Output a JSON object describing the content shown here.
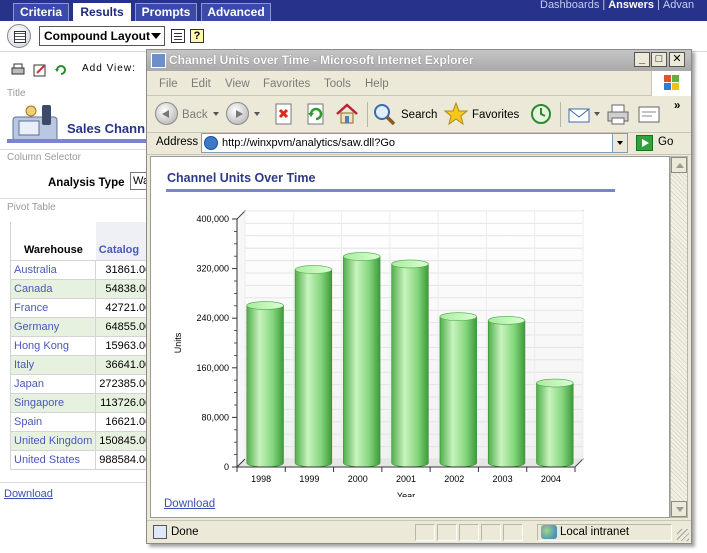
{
  "app": {
    "tabs": [
      {
        "label": "Criteria"
      },
      {
        "label": "Results"
      },
      {
        "label": "Prompts"
      },
      {
        "label": "Advanced"
      }
    ],
    "active_tab": "Results",
    "top_links": [
      "Dashboards",
      "Answers",
      "Advan"
    ],
    "layout_select": "Compound Layout",
    "add_view_label": "Add View:",
    "title_section_label": "Title",
    "title_text": "Sales Chann",
    "column_selector_label": "Column Selector",
    "analysis_type_label": "Analysis Type",
    "analysis_type_value": "Wa",
    "pivot_section_label": "Pivot Table",
    "pivot": {
      "headers": [
        "Warehouse",
        "Catalog"
      ],
      "rows": [
        {
          "name": "Australia",
          "value": "31861.00"
        },
        {
          "name": "Canada",
          "value": "54838.00"
        },
        {
          "name": "France",
          "value": "42721.00"
        },
        {
          "name": "Germany",
          "value": "64855.00"
        },
        {
          "name": "Hong Kong",
          "value": "15963.00"
        },
        {
          "name": "Italy",
          "value": "36641.00"
        },
        {
          "name": "Japan",
          "value": "272385.00"
        },
        {
          "name": "Singapore",
          "value": "113726.00"
        },
        {
          "name": "Spain",
          "value": "16621.00"
        },
        {
          "name": "United Kingdom",
          "value": "150845.00"
        },
        {
          "name": "United States",
          "value": "988584.00"
        }
      ]
    },
    "download_label": "Download"
  },
  "ie": {
    "title": "Channel Units over Time - Microsoft Internet Explorer",
    "menu": [
      "File",
      "Edit",
      "View",
      "Favorites",
      "Tools",
      "Help"
    ],
    "toolbar": {
      "back": "Back",
      "search": "Search",
      "favorites": "Favorites"
    },
    "address_label": "Address",
    "url": "http://winxpvm/analytics/saw.dll?Go",
    "go_label": "Go",
    "status": "Done",
    "zone": "Local intranet",
    "download_label": "Download",
    "icons": [
      "ie-page-icon",
      "back-icon",
      "forward-icon",
      "stop-icon",
      "refresh-icon",
      "home-icon",
      "search-icon",
      "favorites-star-icon",
      "history-icon",
      "mail-icon",
      "print-icon",
      "edit-icon",
      "windows-logo-icon",
      "go-arrow-icon"
    ]
  },
  "chart_data": {
    "type": "bar",
    "title": "Channel Units Over Time",
    "xlabel": "Year",
    "ylabel": "Units",
    "categories": [
      "1998",
      "1999",
      "2000",
      "2001",
      "2002",
      "2003",
      "2004"
    ],
    "values": [
      254000,
      312000,
      333000,
      321000,
      236000,
      230000,
      129000
    ],
    "ylim": [
      0,
      400000
    ],
    "yticks": [
      0,
      80000,
      160000,
      240000,
      320000,
      400000
    ],
    "ytick_labels": [
      "0",
      "80,000",
      "160,000",
      "240,000",
      "320,000",
      "400,000"
    ],
    "bar_color": "#7fd27a",
    "bar_style": "3d-cylinder",
    "grid": true
  }
}
